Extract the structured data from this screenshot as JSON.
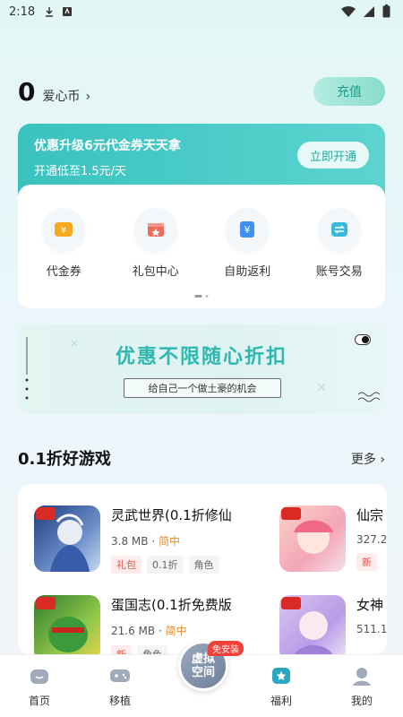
{
  "status_bar": {
    "time": "2:18"
  },
  "coins": {
    "count": "0",
    "label": "爱心币"
  },
  "recharge_label": "充值",
  "vip": {
    "title": "优惠升级6元代金券天天拿",
    "subtitle": "开通低至1.5元/天",
    "button": "立即开通"
  },
  "features": [
    {
      "label": "代金券",
      "icon": "voucher-icon",
      "color": "#f6a823"
    },
    {
      "label": "礼包中心",
      "icon": "gift-box-icon",
      "color": "#f06b5b"
    },
    {
      "label": "自助返利",
      "icon": "rebate-yen-icon",
      "color": "#3b8ff5"
    },
    {
      "label": "账号交易",
      "icon": "account-trade-icon",
      "color": "#37b9d8"
    }
  ],
  "banner": {
    "title": "优惠不限随心折扣",
    "subtitle": "给自己一个做土豪的机会"
  },
  "section": {
    "title": "0.1折好游戏",
    "more": "更多"
  },
  "games": [
    {
      "name": "灵武世界(0.1折修仙",
      "size": "3.8 MB",
      "sep": "·",
      "genre": "简中",
      "tags": [
        "礼包",
        "0.1折",
        "角色"
      ]
    },
    {
      "name": "仙宗",
      "size": "327.2",
      "sep": "",
      "genre": "",
      "tags": [
        "新"
      ]
    },
    {
      "name": "蛋国志(0.1折免费版",
      "size": "21.6 MB",
      "sep": "·",
      "genre": "简中",
      "tags": [
        "新",
        "角色"
      ]
    },
    {
      "name": "女神",
      "size": "511.1",
      "sep": "",
      "genre": "",
      "tags": []
    }
  ],
  "nav": {
    "home": "首页",
    "port": "移植",
    "center_line1": "虚拟",
    "center_line2": "空间",
    "center_badge": "免安装",
    "welfare": "福利",
    "mine": "我的"
  },
  "colors": {
    "accent": "#39c2bf",
    "tag_red": "#e3574a",
    "genre_orange": "#e5902c"
  }
}
